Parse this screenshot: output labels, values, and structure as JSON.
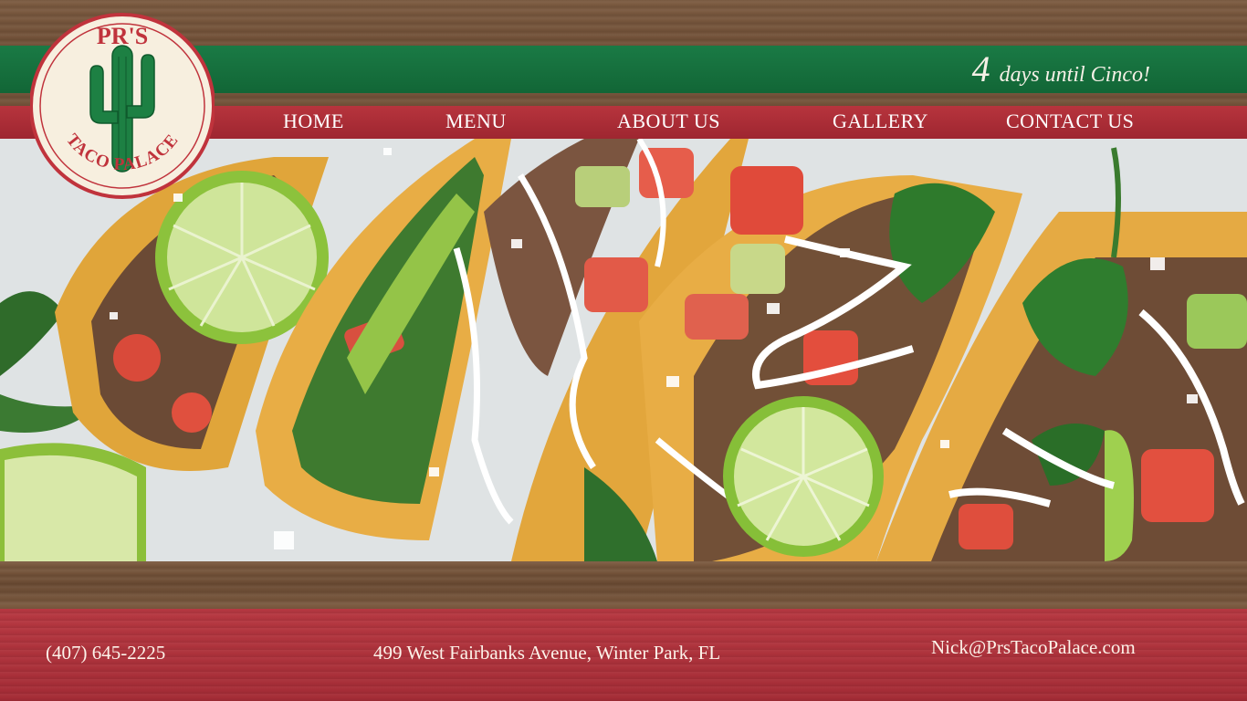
{
  "logo": {
    "top_text": "PR'S",
    "bottom_text": "TACO PALACE"
  },
  "countdown": {
    "number": "4",
    "text": "days until Cinco!"
  },
  "nav": {
    "items": [
      {
        "label": "HOME"
      },
      {
        "label": "MENU"
      },
      {
        "label": "ABOUT US"
      },
      {
        "label": "GALLERY"
      },
      {
        "label": "CONTACT US"
      }
    ]
  },
  "hero": {
    "image": "tacos-photo"
  },
  "footer": {
    "phone": "(407) 645-2225",
    "address": "499 West Fairbanks Avenue, Winter Park, FL",
    "email": "Nick@PrsTacoPalace.com"
  },
  "colors": {
    "green": "#1a7a45",
    "red": "#b7343d",
    "cream": "#f7efdf",
    "logo_red": "#c0333c"
  }
}
